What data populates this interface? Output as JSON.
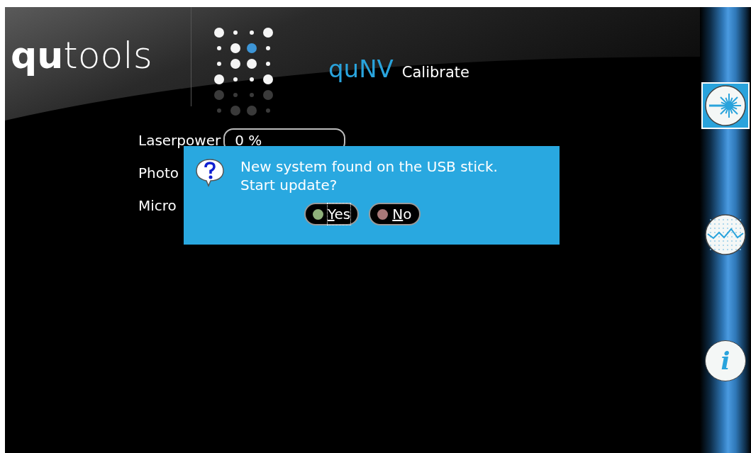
{
  "header": {
    "logo": {
      "bold": "qu",
      "light": "tools"
    },
    "app_name": "quNV",
    "page_title": "Calibrate"
  },
  "form": {
    "rows": [
      {
        "label": "Laserpower",
        "value": "0 %"
      },
      {
        "label": "Photo"
      },
      {
        "label": "Micro"
      }
    ]
  },
  "dialog": {
    "message": "New system found on the USB stick.",
    "question": "Start update?",
    "buttons": [
      {
        "label": "Yes",
        "kind": "yes",
        "selected": true
      },
      {
        "label": "No",
        "kind": "no",
        "selected": false
      }
    ]
  },
  "sidebar": {
    "items": [
      {
        "kind": "laser",
        "selected": true
      },
      {
        "kind": "chart",
        "selected": false
      },
      {
        "kind": "info",
        "glyph": "i",
        "selected": false
      }
    ]
  }
}
